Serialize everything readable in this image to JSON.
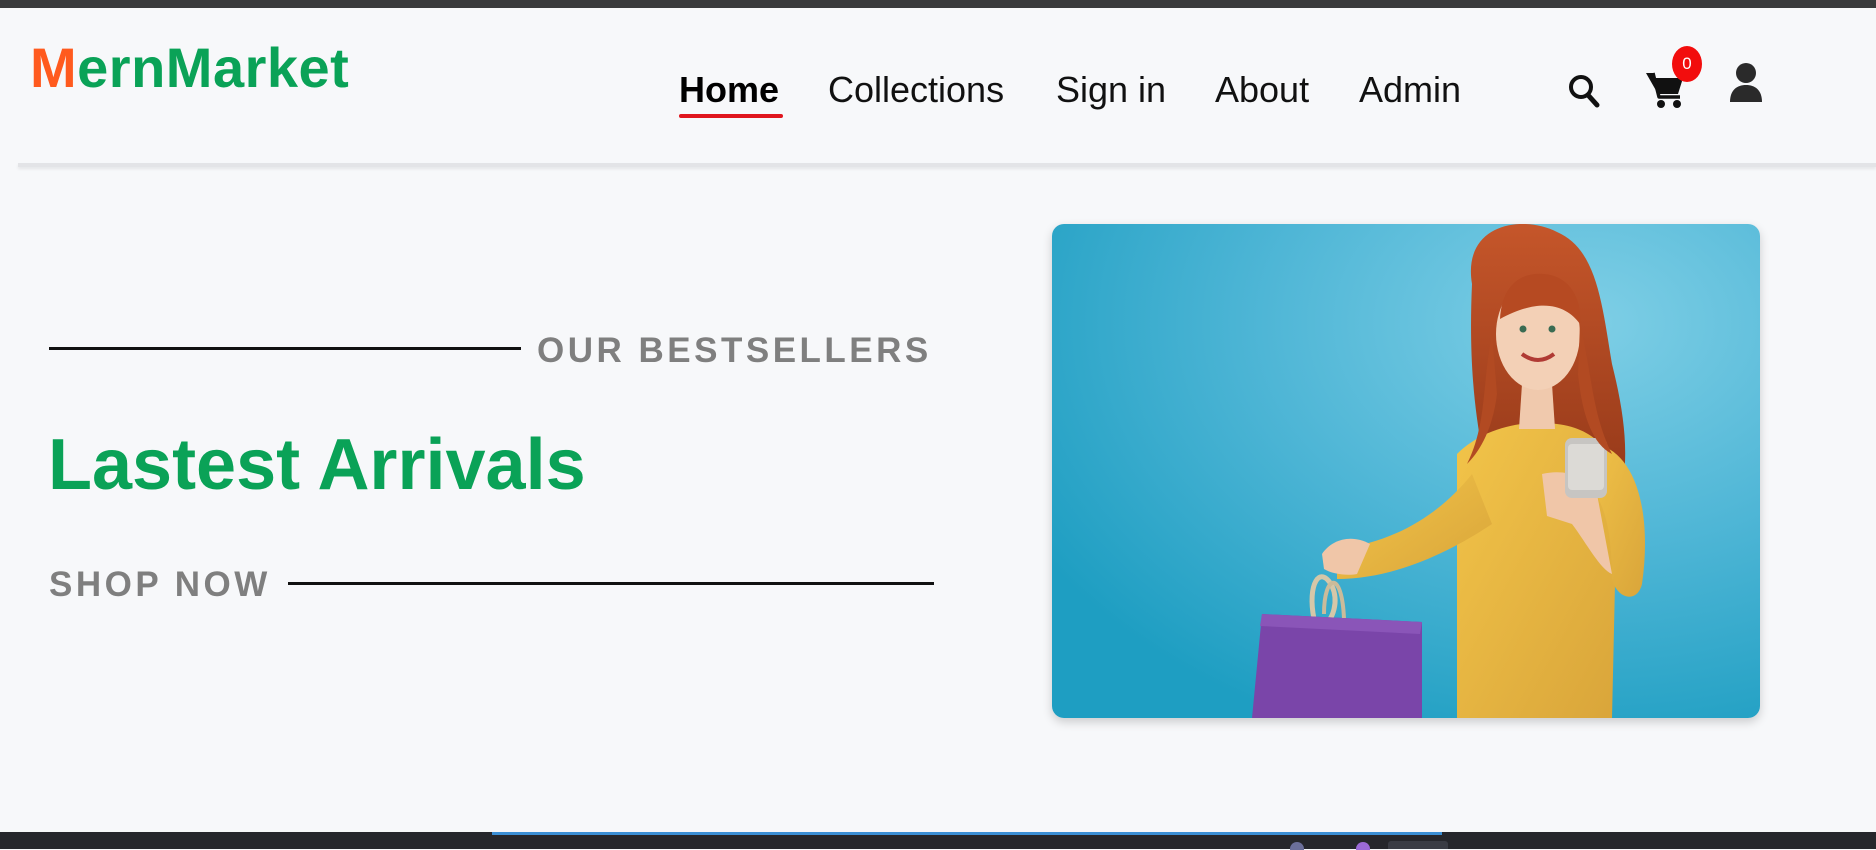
{
  "brand": {
    "initial": "M",
    "rest": "ernMarket",
    "colors": {
      "initial": "#ff5a1e",
      "rest": "#0aa257"
    }
  },
  "nav": {
    "links": [
      {
        "label": "Home",
        "active": true
      },
      {
        "label": "Collections",
        "active": false
      },
      {
        "label": "Sign in",
        "active": false
      },
      {
        "label": "About",
        "active": false
      },
      {
        "label": "Admin",
        "active": false
      }
    ],
    "active_underline_color": "#e0161e"
  },
  "header_icons": {
    "search": "search-icon",
    "cart": "shopping-cart-icon",
    "cart_count": "0",
    "user": "user-icon"
  },
  "hero": {
    "eyebrow": "OUR BESTSELLERS",
    "headline": "Lastest Arrivals",
    "cta": "SHOP NOW",
    "image": "woman holding purple shopping bag and phone on blue background",
    "accent_color": "#0aa257"
  }
}
